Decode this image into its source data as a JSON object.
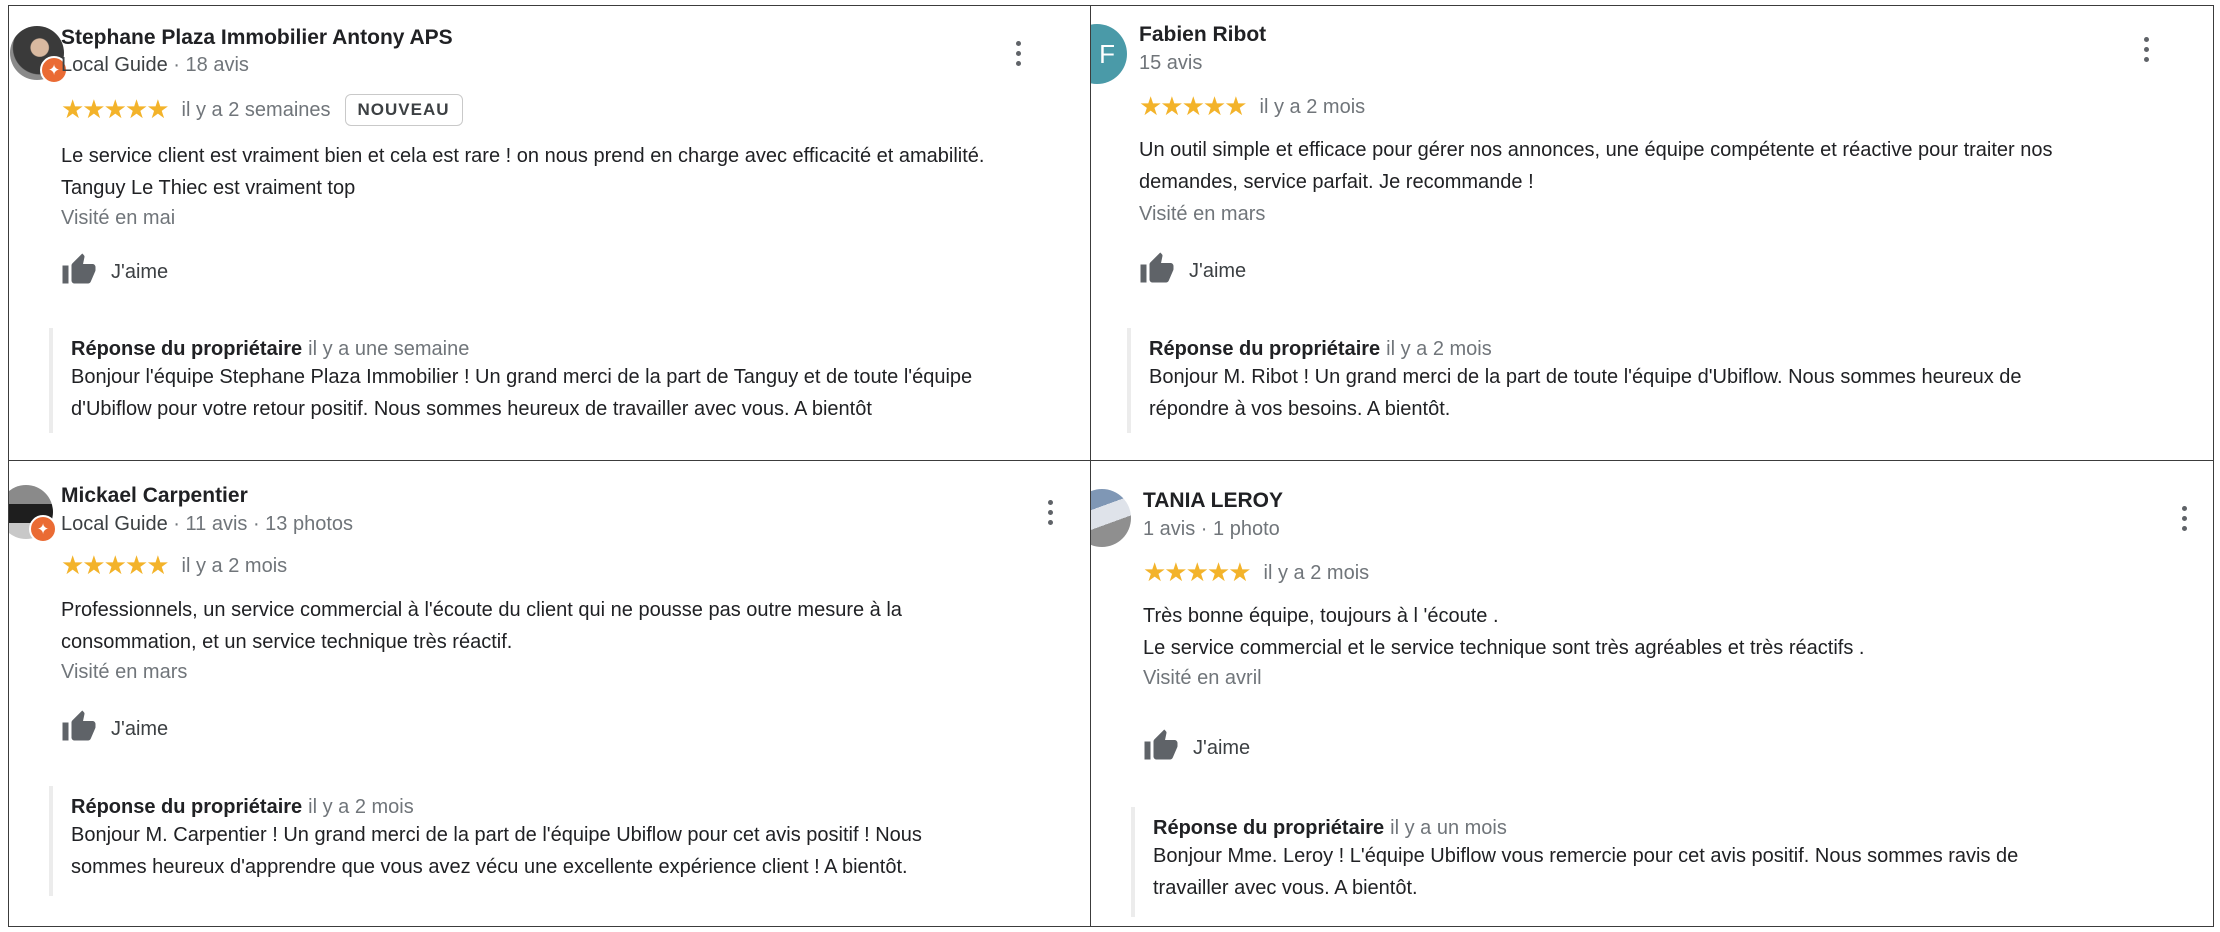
{
  "reviews": [
    {
      "author": "Stephane Plaza Immobilier Antony APS",
      "local_guide": "Local Guide",
      "counts": " · 18 avis",
      "stars": "★★★★★",
      "time": "il y a 2 semaines",
      "new_label": "NOUVEAU",
      "text": "Le service client est vraiment bien et cela est rare ! on nous prend en charge avec efficacité et amabilité.\nTanguy Le Thiec  est vraiment top",
      "visited": "Visité en mai",
      "like_label": "J'aime",
      "reply_owner": "Réponse du propriétaire",
      "reply_time": "il y a une semaine",
      "reply_text": "Bonjour l'équipe Stephane Plaza Immobilier ! Un grand merci de la part de Tanguy et de toute l'équipe\nd'Ubiflow pour votre retour positif. Nous sommes heureux de travailler avec vous. A bientôt"
    },
    {
      "author": "Fabien Ribot",
      "counts": "15 avis",
      "avatar_letter": "F",
      "stars": "★★★★★",
      "time": "il y a 2 mois",
      "text": "Un outil simple et efficace pour gérer nos annonces, une équipe compétente et réactive pour traiter nos\ndemandes, service parfait. Je recommande !",
      "visited": "Visité en mars",
      "like_label": "J'aime",
      "reply_owner": "Réponse du propriétaire",
      "reply_time": "il y a 2 mois",
      "reply_text": "Bonjour M. Ribot ! Un grand merci de la part de toute l'équipe d'Ubiflow. Nous sommes heureux de\nrépondre à vos besoins. A bientôt."
    },
    {
      "author": "Mickael Carpentier",
      "local_guide": "Local Guide",
      "counts": " · 11 avis · 13 photos",
      "stars": "★★★★★",
      "time": "il y a 2 mois",
      "text": "Professionnels, un service commercial à l'écoute du client qui ne pousse pas outre mesure  à la\nconsommation, et un service technique très réactif.",
      "visited": "Visité en mars",
      "like_label": "J'aime",
      "reply_owner": "Réponse du propriétaire",
      "reply_time": "il y a 2 mois",
      "reply_text": "Bonjour M. Carpentier ! Un grand merci de la part de l'équipe Ubiflow pour cet avis positif ! Nous\nsommes heureux d'apprendre que vous avez vécu une excellente expérience client ! A bientôt."
    },
    {
      "author": "TANIA LEROY",
      "counts": "1 avis · 1 photo",
      "stars": "★★★★★",
      "time": "il y a 2 mois",
      "text": "Très bonne équipe, toujours à l 'écoute .\nLe service commercial et le service technique sont très agréables et très réactifs .",
      "visited": "Visité en avril",
      "like_label": "J'aime",
      "reply_owner": "Réponse du propriétaire",
      "reply_time": "il y a un mois",
      "reply_text": "Bonjour Mme. Leroy ! L'équipe Ubiflow vous remercie pour cet avis positif. Nous sommes ravis de\ntravailler avec vous. A bientôt."
    }
  ],
  "colors": {
    "star": "#f3b32a",
    "local_guide_badge": "#ea6b34",
    "avatar_teal": "#4a9aa8",
    "secondary_text": "#70757a"
  },
  "icons": {
    "more": "more-vert-icon",
    "like": "thumb-up-icon",
    "badge": "local-guide-badge-icon"
  }
}
